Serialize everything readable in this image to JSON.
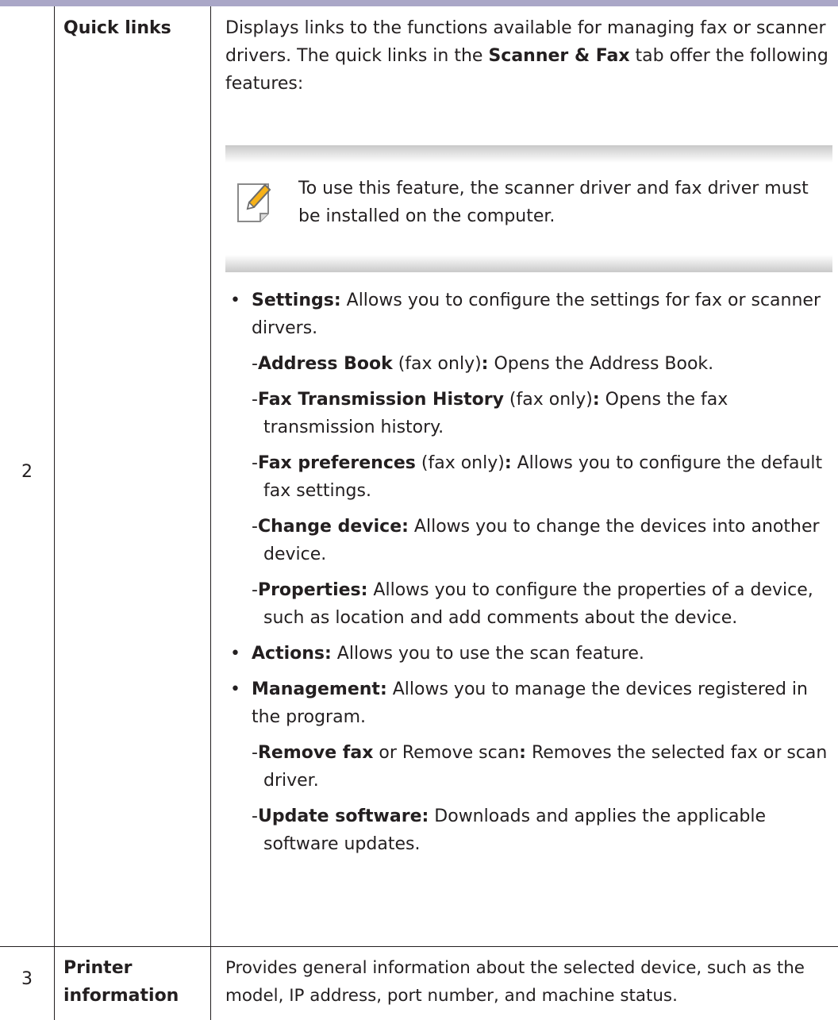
{
  "rows": [
    {
      "number": "2",
      "label": "Quick links",
      "intro": {
        "part1": "Displays links to the functions available for managing fax or scanner drivers. The quick links in the ",
        "bold": "Scanner & Fax",
        "part2": " tab offer the following features:"
      },
      "note": {
        "icon": "note-pencil-icon",
        "text": "To use this feature, the scanner driver and fax driver must be installed on the computer."
      },
      "bullets": [
        {
          "bullet": "•",
          "term": "Settings:",
          "text": " Allows you to configure the settings for fax or scanner dirvers.",
          "subs": [
            {
              "dash": "-",
              "term": "Address Book",
              "qual": " (fax only)",
              "colon": ":",
              "text": " Opens the Address Book."
            },
            {
              "dash": "-",
              "term": "Fax Transmission History",
              "qual": " (fax only)",
              "colon": ":",
              "text": " Opens the fax transmission history."
            },
            {
              "dash": "-",
              "term": "Fax preferences",
              "qual": " (fax only)",
              "colon": ":",
              "text": " Allows you to configure the default fax settings."
            },
            {
              "dash": "-",
              "term": "Change device:",
              "qual": "",
              "colon": "",
              "text": " Allows you to change the devices into another device."
            },
            {
              "dash": "-",
              "term": "Properties:",
              "qual": "",
              "colon": "",
              "text": " Allows you to configure the properties of a device, such as location and add comments about the device."
            }
          ]
        },
        {
          "bullet": "•",
          "term": "Actions:",
          "text": " Allows you to use the scan feature.",
          "subs": []
        },
        {
          "bullet": "•",
          "term": "Management:",
          "text": " Allows you to manage the devices registered in the program.",
          "subs": [
            {
              "dash": "-",
              "term": "Remove fax",
              "qual": " or Remove scan",
              "colon": ":",
              "text": " Removes the selected fax or scan driver."
            },
            {
              "dash": "-",
              "term": "Update software:",
              "qual": "",
              "colon": "",
              "text": " Downloads and applies the applicable software updates."
            }
          ]
        }
      ]
    },
    {
      "number": "3",
      "label": "Printer information",
      "text": "Provides general information about the selected device, such as the model, IP address, port number, and machine status."
    }
  ],
  "colors": {
    "header_rule": "#aaa7c7",
    "note_shade": "#c9c9c9",
    "text": "#231f20",
    "icon_accent": "#f6b21a"
  }
}
